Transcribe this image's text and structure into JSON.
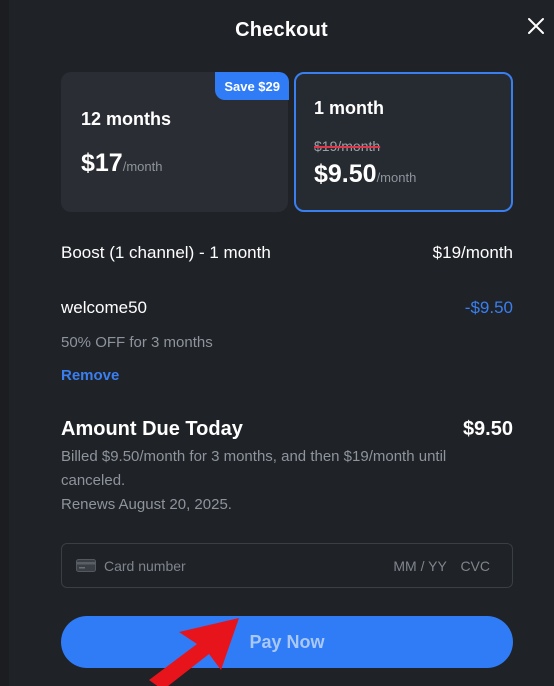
{
  "title": "Checkout",
  "plans": [
    {
      "name": "12 months",
      "badge": "Save $29",
      "price": "$17",
      "unit": "/month",
      "selected": false
    },
    {
      "name": "1 month",
      "old_price": "$19/month",
      "price": "$9.50",
      "unit": "/month",
      "selected": true
    }
  ],
  "line_item": {
    "label": "Boost (1 channel) - 1 month",
    "value": "$19/month"
  },
  "coupon": {
    "code": "welcome50",
    "discount": "-$9.50",
    "description": "50% OFF for 3 months",
    "remove_label": "Remove"
  },
  "amount_due": {
    "label": "Amount Due Today",
    "value": "$9.50",
    "billed_text": "Billed $9.50/month for 3 months, and then $19/month until canceled.",
    "renews_text": "Renews August 20, 2025."
  },
  "card_input": {
    "number_placeholder": "Card number",
    "expiry_placeholder": "MM / YY",
    "cvc_placeholder": "CVC",
    "icon": "credit-card-icon"
  },
  "pay_label": "Pay Now",
  "colors": {
    "accent": "#2f7cf6",
    "danger": "#e0364a",
    "annotation_arrow": "#e8141b"
  }
}
